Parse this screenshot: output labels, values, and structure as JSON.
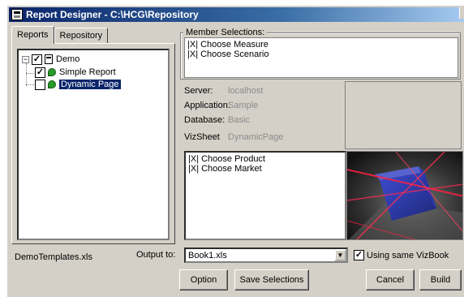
{
  "window": {
    "title": "Report Designer - C:\\HCG\\Repository"
  },
  "tabs": [
    {
      "label": "Reports"
    },
    {
      "label": "Repository"
    }
  ],
  "tree": {
    "root": {
      "label": "Demo",
      "checked": true
    },
    "children": [
      {
        "label": "Simple Report",
        "checked": true
      },
      {
        "label": "Dynamic Page",
        "checked": false,
        "selected": true
      }
    ]
  },
  "member_selections": {
    "label": "Member Selections:",
    "items": [
      "|X| Choose Measure",
      "|X| Choose Scenario"
    ]
  },
  "info": {
    "server_label": "Server:",
    "server_value": "localhost",
    "application_label": "Application:",
    "application_value": "Sample",
    "database_label": "Database:",
    "database_value": "Basic",
    "vizsheet_label": "VizSheet",
    "vizsheet_value": "DynamicPage"
  },
  "dimension_selections": {
    "items": [
      "|X| Choose Product",
      "|X| Choose Market"
    ]
  },
  "footer": {
    "template_file": "DemoTemplates.xls",
    "output_label": "Output to:",
    "output_value": "Book1.xls",
    "use_same_vizbook_label": "Using same VizBook",
    "use_same_vizbook_checked": true
  },
  "buttons": {
    "option": "Option",
    "save_selections": "Save Selections",
    "cancel": "Cancel",
    "build": "Build"
  },
  "colors": {
    "titlebar": "#0a246a",
    "selection": "#0a246a",
    "dialog_bg": "#d4d0c8"
  }
}
